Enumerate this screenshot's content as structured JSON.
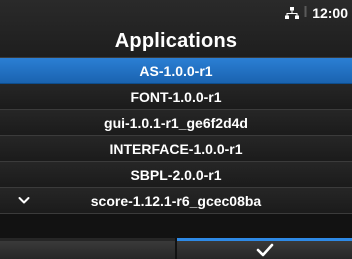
{
  "header": {
    "title": "Applications",
    "time": "12:00",
    "network_icon": "network-icon"
  },
  "applications": {
    "items": [
      {
        "label": "AS-1.0.0-r1",
        "selected": true
      },
      {
        "label": "FONT-1.0.0-r1",
        "selected": false
      },
      {
        "label": "gui-1.0.1-r1_ge6f2d4d",
        "selected": false
      },
      {
        "label": "INTERFACE-1.0.0-r1",
        "selected": false
      },
      {
        "label": "SBPL-2.0.0-r1",
        "selected": false
      },
      {
        "label": "score-1.12.1-r6_gcec08ba",
        "selected": false
      }
    ],
    "more_icon": "chevron-down-icon"
  },
  "footer": {
    "left_key": "",
    "right_key_icon": "checkmark-icon"
  },
  "colors": {
    "accent": "#1f6fbf",
    "footer_active": "#2e8ae6",
    "background": "#121212"
  }
}
